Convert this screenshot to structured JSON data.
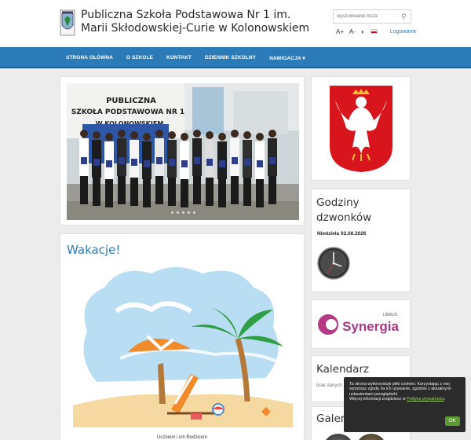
{
  "header": {
    "school_name": "Publiczna Szkoła Podstawowa Nr 1 im. Marii Skłodowskiej-Curie w Kolonowskiem",
    "search_placeholder": "wyszukiwanie fraza",
    "font_increase": "A+",
    "font_decrease": "A-",
    "contrast_icon": "contrast-icon",
    "language_flag": "polish-flag-icon",
    "login": "Logowanie"
  },
  "side_toggle": {
    "icon": "menu-icon"
  },
  "nav": {
    "items": [
      "STRONA GŁÓWNA",
      "O SZKOLE",
      "KONTAKT",
      "DZIENNIK SZKOLNY",
      "NAWIGACJA ▾"
    ]
  },
  "slider": {
    "sign_text": [
      "PUBLICZNA",
      "SZKOŁA PODSTAWOWA NR 1",
      "W KOLONOWSKIEM"
    ],
    "dots": 5
  },
  "article": {
    "title": "Wakacje!",
    "caption": "Uczniom i ich Rodzicom"
  },
  "sidebar": {
    "bells": {
      "title": "Godziny dzwonków",
      "date": "Niedziela 02.08.2026"
    },
    "synergia": {
      "brand": "LIBRUS",
      "name": "Synergia"
    },
    "calendar": {
      "title": "Kalendarz",
      "note": "brak danych"
    },
    "gallery": {
      "title": "Galeria zdjęć"
    }
  },
  "cookie": {
    "text": "Ta strona wykorzystuje pliki cookies. Korzystając z niej wyrażasz zgodę na ich używanie, zgodnie z aktualnymi ustawieniami przeglądarki.",
    "more_prefix": "Więcej informacji znajdziesz w ",
    "link": "Polityce prywatności",
    "more_suffix": ".",
    "ok": "OK"
  },
  "colors": {
    "accent": "#2b7bb9",
    "nav_bg": "#2b7bb9",
    "ok_button": "#5a9a2e"
  }
}
